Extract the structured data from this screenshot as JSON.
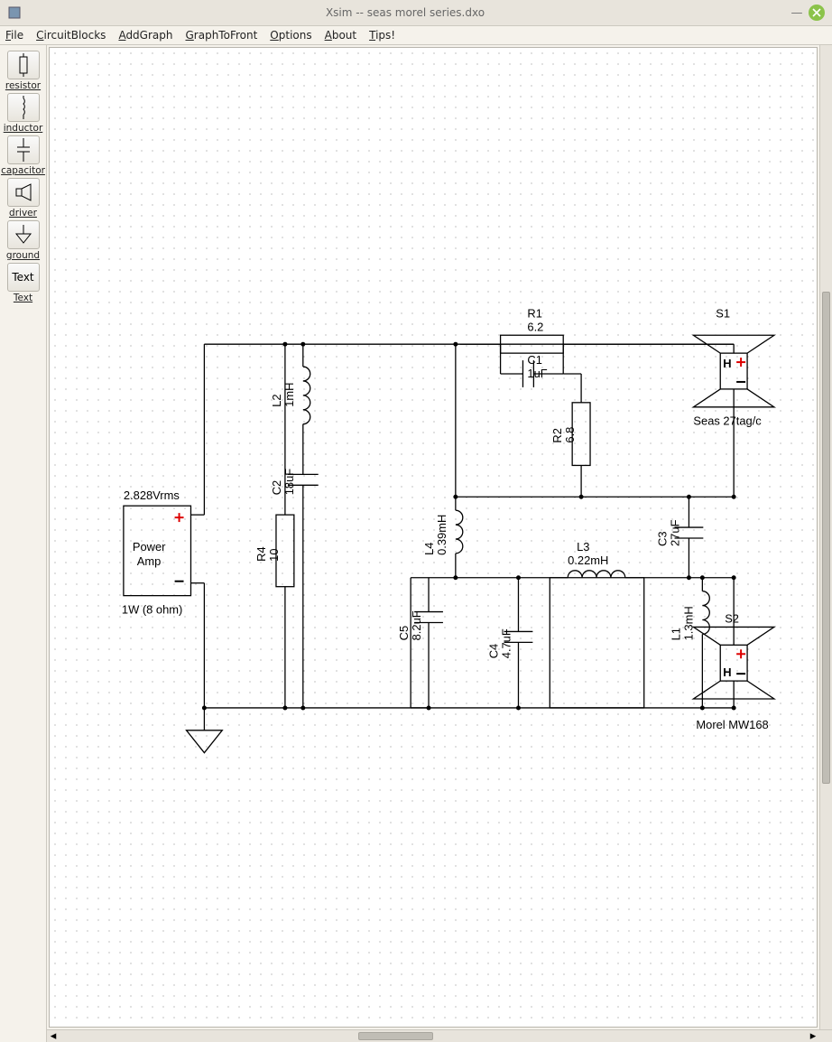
{
  "window": {
    "title": "Xsim -- seas morel series.dxo"
  },
  "menu": {
    "items": [
      {
        "label": "File",
        "u": 0
      },
      {
        "label": "CircuitBlocks",
        "u": 0
      },
      {
        "label": "AddGraph",
        "u": 0
      },
      {
        "label": "GraphToFront",
        "u": 0
      },
      {
        "label": "Options",
        "u": 0
      },
      {
        "label": "About",
        "u": 0
      },
      {
        "label": "Tips!",
        "u": 0
      }
    ]
  },
  "tools": {
    "resistor": "resistor",
    "inductor": "inductor",
    "capacitor": "capacitor",
    "driver": "driver",
    "ground": "ground",
    "text": "Text"
  },
  "schematic": {
    "amp": {
      "name": "Power",
      "name2": "Amp",
      "vrms": "2.828Vrms",
      "power": "1W (8 ohm)"
    },
    "R1": {
      "name": "R1",
      "value": "6.2"
    },
    "R2": {
      "name": "R2",
      "value": "6.8"
    },
    "R4": {
      "name": "R4",
      "value": "10"
    },
    "L1": {
      "name": "L1",
      "value": "1.3mH"
    },
    "L2": {
      "name": "L2",
      "value": "1mH"
    },
    "L3": {
      "name": "L3",
      "value": "0.22mH"
    },
    "L4": {
      "name": "L4",
      "value": "0.39mH"
    },
    "C1": {
      "name": "C1",
      "value": "1uF"
    },
    "C2": {
      "name": "C2",
      "value": "18uF"
    },
    "C3": {
      "name": "C3",
      "value": "27uF"
    },
    "C4": {
      "name": "C4",
      "value": "4.7uF"
    },
    "C5": {
      "name": "C5",
      "value": "8.2uF"
    },
    "S1": {
      "name": "S1",
      "label": "Seas 27tag/c"
    },
    "S2": {
      "name": "S2",
      "label": "Morel MW168"
    }
  }
}
